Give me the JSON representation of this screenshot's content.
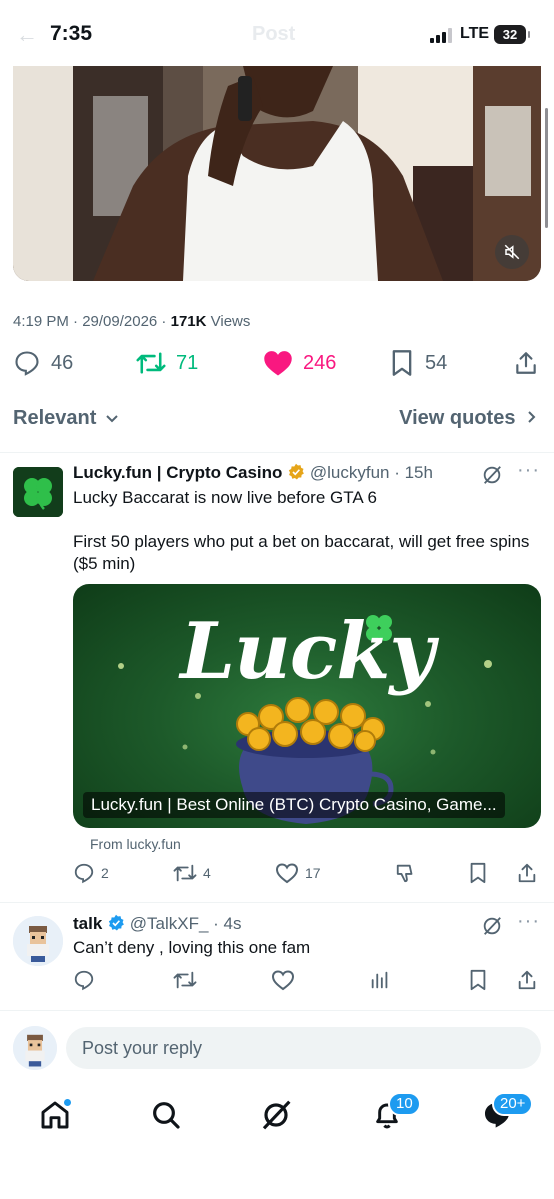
{
  "status_bar": {
    "time": "7:35",
    "network": "LTE",
    "battery": "32"
  },
  "header": {
    "title": "Post"
  },
  "post": {
    "timestamp": "4:19 PM · 29/09/2026 · ",
    "views_count": "171K",
    "views_label": " Views",
    "actions": {
      "replies": "46",
      "reposts": "71",
      "likes": "246",
      "bookmarks": "54"
    }
  },
  "sort": {
    "label": "Relevant",
    "view_quotes": "View quotes"
  },
  "replies": [
    {
      "name": "Lucky.fun | Crypto Casino",
      "handle": "@luckyfun · 15h",
      "text_line1": "Lucky Baccarat is now live before GTA 6",
      "text_line2": "First 50 players who put a bet on baccarat, will get free spins ($5 min)",
      "card_title": "Lucky",
      "card_caption": "Lucky.fun | Best Online (BTC) Crypto Casino, Game...",
      "from": "From lucky.fun",
      "stats": {
        "replies": "2",
        "reposts": "4",
        "likes": "17"
      }
    },
    {
      "name": "talk",
      "handle": "@TalkXF_ · 4s",
      "text": "Can’t deny , loving this one fam"
    }
  ],
  "reply_box": {
    "placeholder": "Post your reply"
  },
  "nav": {
    "notifications_badge": "10",
    "messages_badge": "20+"
  },
  "colors": {
    "accent": "#1d9bf0",
    "like": "#f91880",
    "repost": "#00ba7c",
    "verified": "#e6a519"
  }
}
